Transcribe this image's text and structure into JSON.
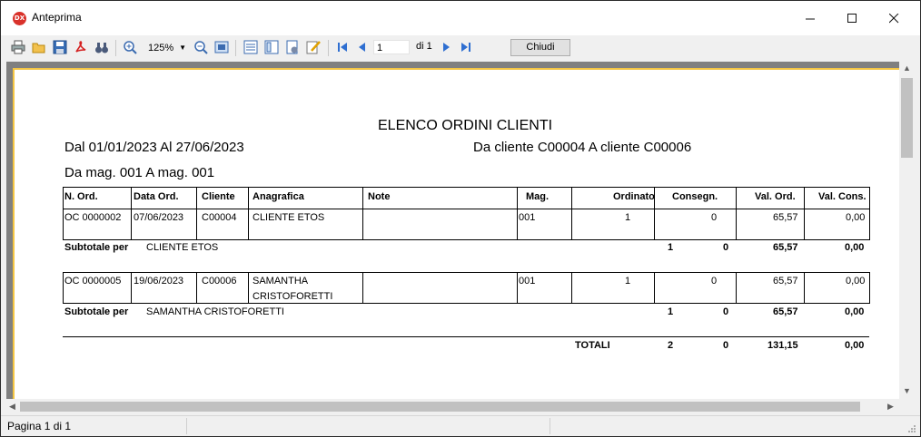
{
  "window": {
    "title": "Anteprima",
    "icon_label": "DX"
  },
  "toolbar": {
    "zoom": "125%",
    "page_value": "1",
    "page_of": "di 1",
    "close_label": "Chiudi"
  },
  "status": {
    "page": "Pagina 1 di 1"
  },
  "report": {
    "title": "ELENCO ORDINI CLIENTI",
    "date_range": "Dal 01/01/2023 Al 27/06/2023",
    "client_range": "Da cliente C00004 A cliente C00006",
    "store_range": "Da mag. 001 A mag. 001",
    "headers": [
      "N. Ord.",
      "Data Ord.",
      "Cliente",
      "Anagrafica",
      "Note",
      "Mag.",
      "Ordinato",
      "Consegn.",
      "Val. Ord.",
      "Val. Cons."
    ],
    "orders": [
      {
        "num": "OC 0000002",
        "date": "07/06/2023",
        "client": "C00004",
        "name1": "CLIENTE ETOS",
        "name2": "",
        "note": "",
        "mag": "001",
        "ordinato": "1",
        "consegn": "0",
        "val_ord": "65,57",
        "val_cons": "0,00",
        "subtotal_label": "Subtotale per",
        "subtotal_name": "CLIENTE ETOS",
        "sub_ordinato": "1",
        "sub_consegn": "0",
        "sub_val_ord": "65,57",
        "sub_val_cons": "0,00"
      },
      {
        "num": "OC 0000005",
        "date": "19/06/2023",
        "client": "C00006",
        "name1": "SAMANTHA",
        "name2": "CRISTOFORETTI",
        "note": "",
        "mag": "001",
        "ordinato": "1",
        "consegn": "0",
        "val_ord": "65,57",
        "val_cons": "0,00",
        "subtotal_label": "Subtotale per",
        "subtotal_name": "SAMANTHA CRISTOFORETTI",
        "sub_ordinato": "1",
        "sub_consegn": "0",
        "sub_val_ord": "65,57",
        "sub_val_cons": "0,00"
      }
    ],
    "totals": {
      "label": "TOTALI",
      "ordinato": "2",
      "consegn": "0",
      "val_ord": "131,15",
      "val_cons": "0,00"
    }
  }
}
